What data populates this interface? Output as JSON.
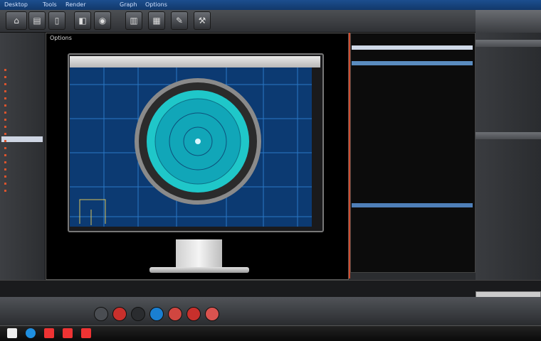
{
  "app": {
    "title_items": [
      "Desktop",
      "Tools",
      "Render",
      "Graph",
      "Options"
    ]
  },
  "main": {
    "header": "Options"
  },
  "colors": {
    "accent": "#1c4f8f",
    "screen_bg": "#0c3a72",
    "ring": "#1fc7c9",
    "log_bullet": "#d9542e"
  },
  "icons": [
    "app-icon",
    "toolbar-icons",
    "disc-target-icon",
    "taskbar-icons"
  ]
}
